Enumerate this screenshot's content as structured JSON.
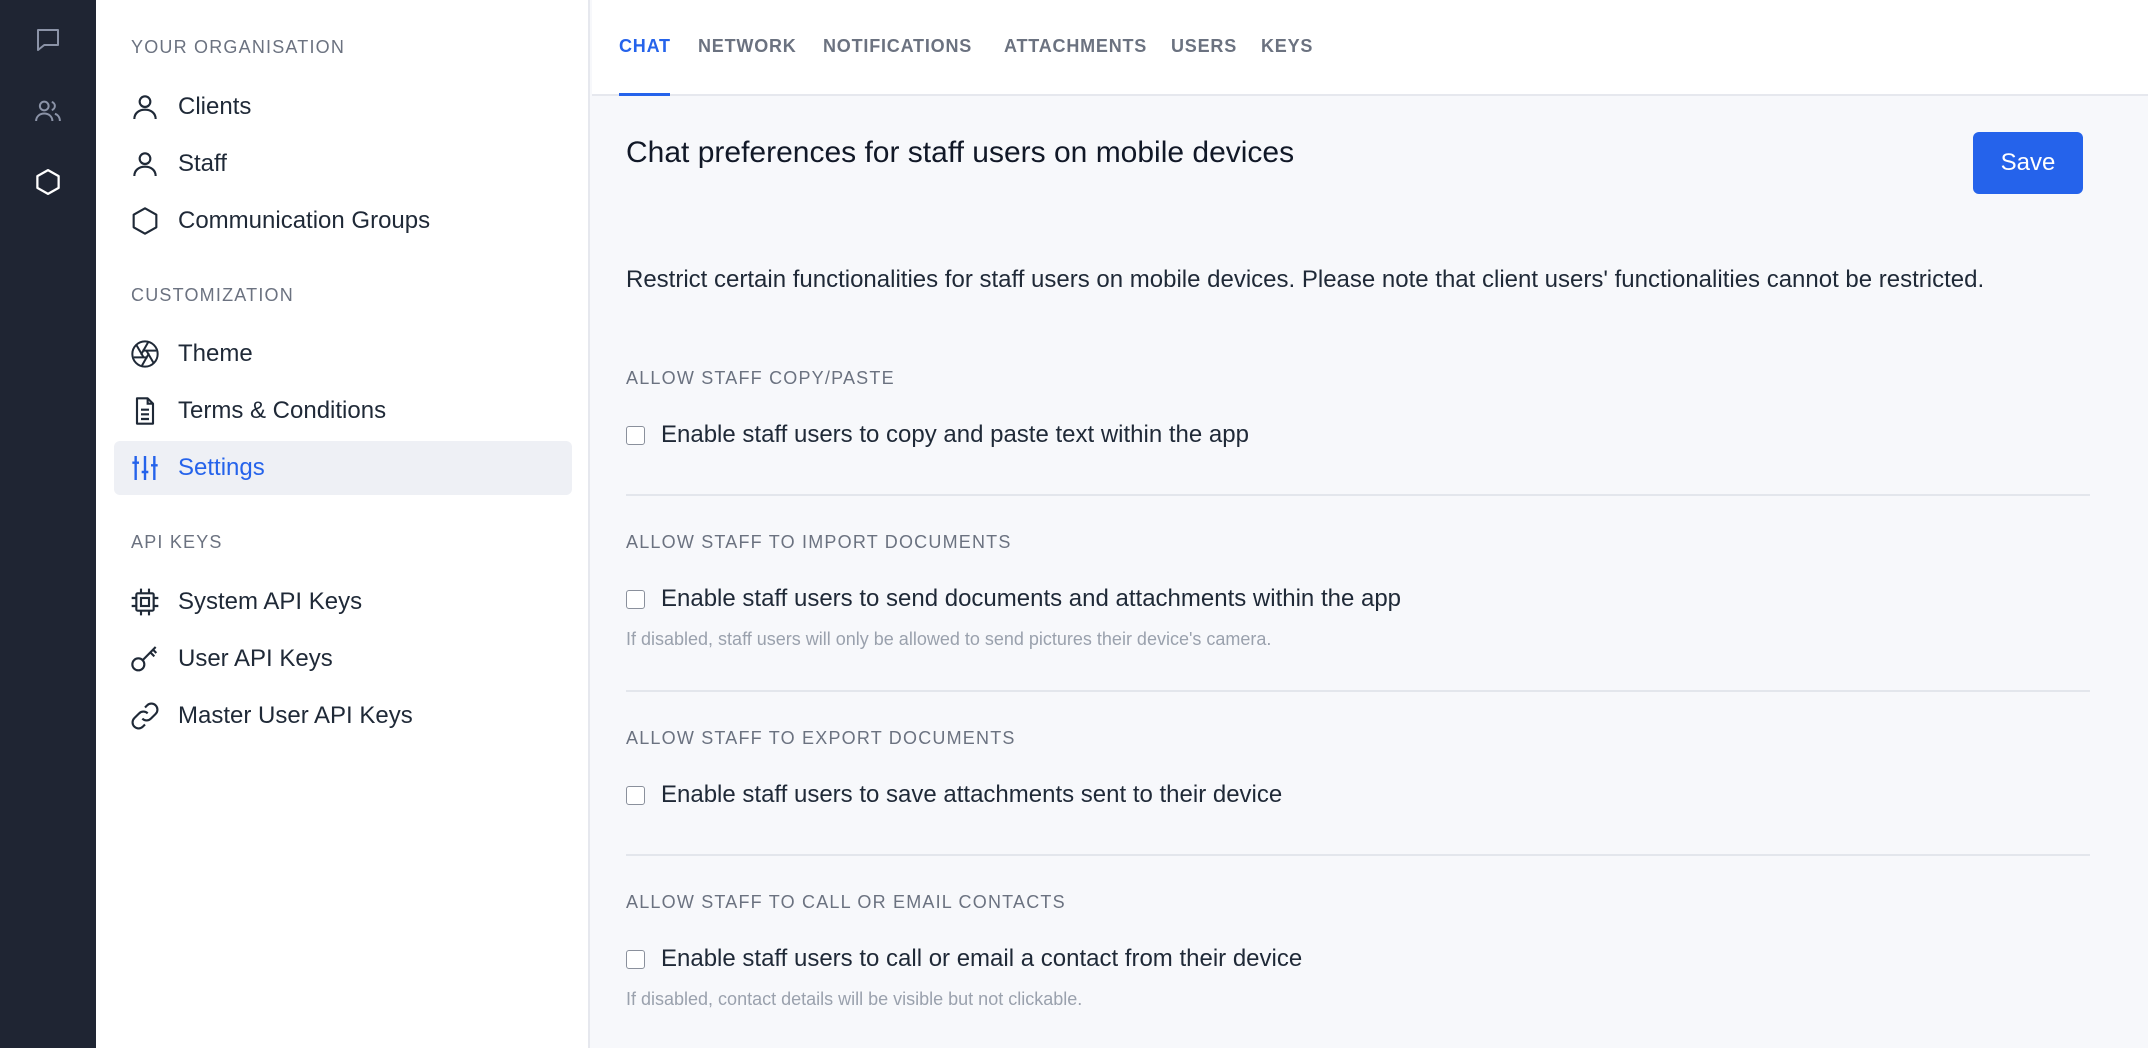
{
  "rail": {
    "items": [
      {
        "icon": "chat-bubble-icon"
      },
      {
        "icon": "users-icon"
      },
      {
        "icon": "hexagon-icon"
      }
    ]
  },
  "sidebar": {
    "sections": [
      {
        "title": "YOUR ORGANISATION",
        "items": [
          {
            "label": "Clients",
            "icon": "user-icon"
          },
          {
            "label": "Staff",
            "icon": "user-icon"
          },
          {
            "label": "Communication Groups",
            "icon": "hexagon-icon"
          }
        ]
      },
      {
        "title": "CUSTOMIZATION",
        "items": [
          {
            "label": "Theme",
            "icon": "aperture-icon"
          },
          {
            "label": "Terms & Conditions",
            "icon": "document-icon"
          },
          {
            "label": "Settings",
            "icon": "sliders-icon",
            "active": true
          }
        ]
      },
      {
        "title": "API KEYS",
        "items": [
          {
            "label": "System API Keys",
            "icon": "chip-icon"
          },
          {
            "label": "User API Keys",
            "icon": "key-icon"
          },
          {
            "label": "Master User API Keys",
            "icon": "link-icon"
          }
        ]
      }
    ]
  },
  "tabs": [
    {
      "label": "CHAT",
      "active": true
    },
    {
      "label": "NETWORK"
    },
    {
      "label": "NOTIFICATIONS"
    },
    {
      "label": "ATTACHMENTS"
    },
    {
      "label": "USERS"
    },
    {
      "label": "KEYS"
    }
  ],
  "main": {
    "title": "Chat preferences for staff users on mobile devices",
    "save_label": "Save",
    "description": "Restrict certain functionalities for staff users on mobile devices. Please note that client users' functionalities cannot be restricted.",
    "settings": [
      {
        "label": "ALLOW STAFF COPY/PASTE",
        "checkbox_label": "Enable staff users to copy and paste text within the app",
        "checked": false
      },
      {
        "label": "ALLOW STAFF TO IMPORT DOCUMENTS",
        "checkbox_label": "Enable staff users to send documents and attachments within the app",
        "hint": "If disabled, staff users will only be allowed to send pictures their device's camera.",
        "checked": false
      },
      {
        "label": "ALLOW STAFF TO EXPORT DOCUMENTS",
        "checkbox_label": "Enable staff users to save attachments sent to their device",
        "checked": false
      },
      {
        "label": "ALLOW STAFF TO CALL OR EMAIL CONTACTS",
        "checkbox_label": "Enable staff users to call or email a contact from their device",
        "hint": "If disabled, contact details will be visible but not clickable.",
        "checked": false
      }
    ]
  },
  "colors": {
    "accent": "#2563eb",
    "rail_bg": "#1f2533",
    "active_item_bg": "#eef0f5"
  }
}
